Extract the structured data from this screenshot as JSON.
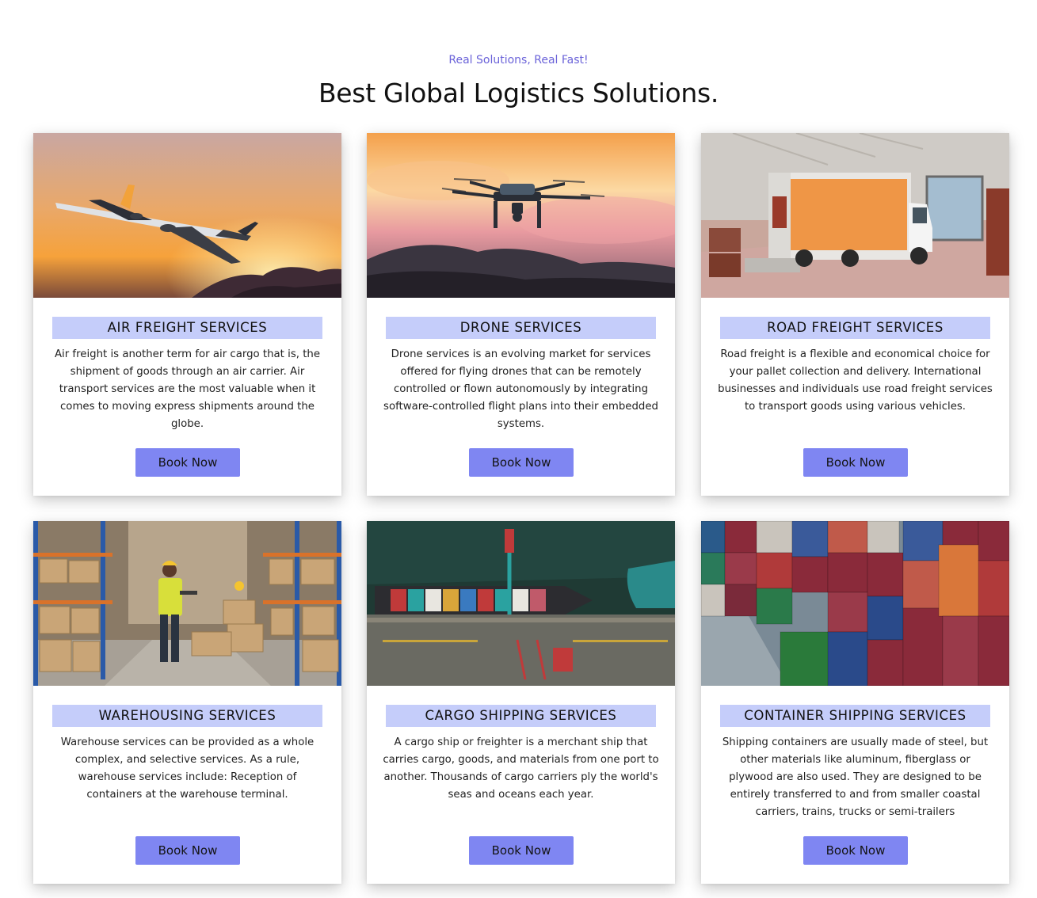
{
  "header": {
    "tagline": "Real Solutions, Real Fast!",
    "title": "Best Global Logistics Solutions."
  },
  "colors": {
    "accent": "#7f86f2",
    "title_band": "#c5cdfa",
    "tagline": "#6b63d9"
  },
  "services": [
    {
      "image": "airplane-sunset-photo",
      "title": "AIR FREIGHT SERVICES",
      "description": "Air freight is another term for air cargo that is, the shipment of goods through an air carrier. Air transport services are the most valuable when it comes to moving express shipments around the globe.",
      "button": "Book Now"
    },
    {
      "image": "drone-sunset-photo",
      "title": "DRONE SERVICES",
      "description": "Drone services is an evolving market for services offered for flying drones that can be remotely controlled or flown autonomously by integrating software-controlled flight plans into their embedded systems.",
      "button": "Book Now"
    },
    {
      "image": "delivery-truck-warehouse-photo",
      "title": "ROAD FREIGHT SERVICES",
      "description": "Road freight is a flexible and economical choice for your pallet collection and delivery. International businesses and individuals use road freight services to transport goods using various vehicles.",
      "button": "Book Now"
    },
    {
      "image": "warehouse-worker-photo",
      "title": "WAREHOUSING SERVICES",
      "description": "Warehouse services can be provided as a whole complex, and selective services. As a rule, warehouse services include: Reception of containers at the warehouse terminal.",
      "button": "Book Now"
    },
    {
      "image": "cargo-ship-port-aerial-photo",
      "title": "CARGO SHIPPING SERVICES",
      "description": "A cargo ship or freighter is a merchant ship that carries cargo, goods, and materials from one port to another. Thousands of cargo carriers ply the world's seas and oceans each year.",
      "button": "Book Now"
    },
    {
      "image": "stacked-containers-photo",
      "title": "CONTAINER SHIPPING SERVICES",
      "description": "Shipping containers are usually made of steel, but other materials like aluminum, fiberglass or plywood are also used. They are designed to be entirely transferred to and from smaller coastal carriers, trains, trucks or semi-trailers",
      "button": "Book Now"
    }
  ]
}
